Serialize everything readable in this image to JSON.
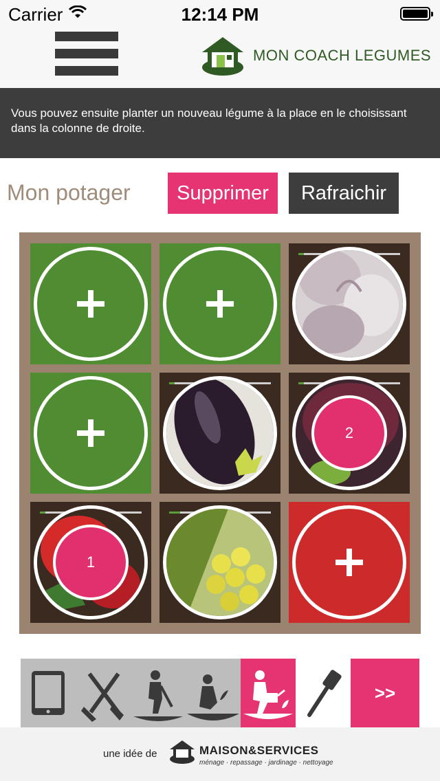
{
  "status_bar": {
    "carrier": "Carrier",
    "time": "12:14 PM",
    "icons": [
      "wifi-icon",
      "battery-icon"
    ]
  },
  "nav": {
    "menu_icon": "hamburger-menu-icon",
    "logo_text": "MON COACH LEGUMES"
  },
  "banner": {
    "text": "Vous pouvez ensuite planter un nouveau légume à la place en le choisissant dans la colonne de droite."
  },
  "garden": {
    "title": "Mon potager",
    "delete_label": "Supprimer",
    "refresh_label": "Rafraichir",
    "cells": [
      {
        "state": "empty",
        "icon": "plus-icon",
        "color": "#4f8c32"
      },
      {
        "state": "empty",
        "icon": "plus-icon",
        "color": "#4f8c32"
      },
      {
        "state": "planted",
        "vegetable_image": "garlic-image",
        "progress": 0.05
      },
      {
        "state": "empty",
        "icon": "plus-icon",
        "color": "#4f8c32"
      },
      {
        "state": "planted",
        "vegetable_image": "eggplant-image",
        "progress": 0.05
      },
      {
        "state": "planted",
        "vegetable_image": "beet-image",
        "count": "2",
        "progress": 0.05
      },
      {
        "state": "planted",
        "vegetable_image": "strawberry-image",
        "count": "1",
        "progress": 0.05
      },
      {
        "state": "planted",
        "vegetable_image": "corn-image",
        "progress": 0.1
      },
      {
        "state": "selected",
        "icon": "plus-icon",
        "color": "#cd2b2b"
      }
    ]
  },
  "toolbar": {
    "steps": [
      {
        "icon": "tablet-icon",
        "state": "inactive"
      },
      {
        "icon": "tools-icon",
        "state": "inactive"
      },
      {
        "icon": "digging-icon",
        "state": "inactive"
      },
      {
        "icon": "planting-icon",
        "state": "inactive"
      },
      {
        "icon": "watering-icon",
        "state": "active"
      },
      {
        "icon": "spatula-icon",
        "state": "light"
      }
    ],
    "next_label": ">>"
  },
  "footer": {
    "prefix": "une idée de",
    "brand": "MAISON&SERVICES",
    "tagline": "ménage · repassage · jardinage · nettoyage"
  },
  "colors": {
    "accent_pink": "#e63371",
    "dark": "#3d3d3d",
    "green": "#4f8c32",
    "red": "#cd2b2b",
    "title_brown": "#a08c7a"
  }
}
